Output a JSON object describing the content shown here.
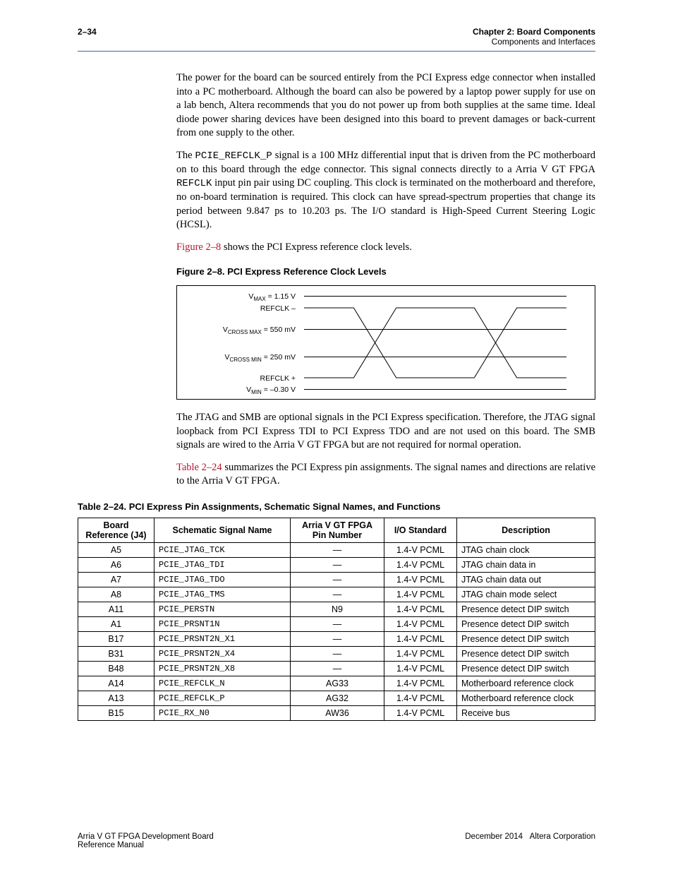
{
  "header": {
    "page_num": "2–34",
    "chapter": "Chapter 2: Board Components",
    "section": "Components and Interfaces"
  },
  "para1": "The power for the board can be sourced entirely from the PCI Express edge connector when installed into a PC motherboard. Although the board can also be powered by a laptop power supply for use on a lab bench, Altera recommends that you do not power up from both supplies at the same time. Ideal diode power sharing devices have been designed into this board to prevent damages or back-current from one supply to the other.",
  "para2_pre": "The ",
  "para2_mono1": "PCIE_REFCLK_P",
  "para2_mid1": " signal is a 100 MHz differential input that is driven from the PC motherboard on to this board through the edge connector. This signal connects directly to a Arria V GT FPGA ",
  "para2_mono2": "REFCLK",
  "para2_mid2": " input pin pair using DC coupling. This clock is terminated on the motherboard and therefore, no on-board termination is required. This clock can have spread-spectrum properties that change its period between 9.847 ps to 10.203 ps. The I/O standard is High-Speed Current Steering Logic (HCSL).",
  "para3_link": "Figure 2–8",
  "para3_rest": " shows the PCI Express reference clock levels.",
  "figure_caption": "Figure 2–8. PCI Express Reference Clock Levels",
  "figure_labels": {
    "vmax": "VMAX = 1.15 V",
    "refclk_minus": "REFCLK –",
    "vcross_max": "VCROSS MAX = 550 mV",
    "vcross_min": "VCROSS MIN = 250 mV",
    "refclk_plus": "REFCLK +",
    "vmin": "VMIN = –0.30 V"
  },
  "chart_data": {
    "type": "line",
    "title": "PCI Express Reference Clock Levels",
    "y_markers": [
      {
        "label": "VMAX",
        "value_v": 1.15
      },
      {
        "label": "REFCLK –",
        "value_v": null
      },
      {
        "label": "VCROSS MAX",
        "value_mv": 550
      },
      {
        "label": "VCROSS MIN",
        "value_mv": 250
      },
      {
        "label": "REFCLK +",
        "value_v": null
      },
      {
        "label": "VMIN",
        "value_v": -0.3
      }
    ],
    "series": [
      {
        "name": "REFCLK +",
        "shape": "differential-cross-upper"
      },
      {
        "name": "REFCLK –",
        "shape": "differential-cross-lower"
      }
    ]
  },
  "para4": "The JTAG and SMB are optional signals in the PCI Express specification. Therefore, the JTAG signal loopback from PCI Express TDI to PCI Express TDO and are not used on this board. The SMB signals are wired to the Arria V GT FPGA but are not required for normal operation.",
  "para5_link": "Table 2–24",
  "para5_rest": " summarizes the PCI Express pin assignments. The signal names and directions are relative to the Arria V GT FPGA.",
  "table_caption": "Table 2–24. PCI Express Pin Assignments, Schematic Signal Names, and Functions",
  "table_headers": {
    "ref": "Board Reference (J4)",
    "sig": "Schematic Signal Name",
    "pin": "Arria V GT FPGA Pin Number",
    "io": "I/O Standard",
    "desc": "Description"
  },
  "table_rows": [
    {
      "ref": "A5",
      "sig": "PCIE_JTAG_TCK",
      "pin": "—",
      "io": "1.4-V PCML",
      "desc": "JTAG chain clock"
    },
    {
      "ref": "A6",
      "sig": "PCIE_JTAG_TDI",
      "pin": "—",
      "io": "1.4-V PCML",
      "desc": "JTAG chain data in"
    },
    {
      "ref": "A7",
      "sig": "PCIE_JTAG_TDO",
      "pin": "—",
      "io": "1.4-V PCML",
      "desc": "JTAG chain data out"
    },
    {
      "ref": "A8",
      "sig": "PCIE_JTAG_TMS",
      "pin": "—",
      "io": "1.4-V PCML",
      "desc": "JTAG chain mode select"
    },
    {
      "ref": "A11",
      "sig": "PCIE_PERSTN",
      "pin": "N9",
      "io": "1.4-V PCML",
      "desc": "Presence detect DIP switch"
    },
    {
      "ref": "A1",
      "sig": "PCIE_PRSNT1N",
      "pin": "—",
      "io": "1.4-V PCML",
      "desc": "Presence detect DIP switch"
    },
    {
      "ref": "B17",
      "sig": "PCIE_PRSNT2N_X1",
      "pin": "—",
      "io": "1.4-V PCML",
      "desc": "Presence detect DIP switch"
    },
    {
      "ref": "B31",
      "sig": "PCIE_PRSNT2N_X4",
      "pin": "—",
      "io": "1.4-V PCML",
      "desc": "Presence detect DIP switch"
    },
    {
      "ref": "B48",
      "sig": "PCIE_PRSNT2N_X8",
      "pin": "—",
      "io": "1.4-V PCML",
      "desc": "Presence detect DIP switch"
    },
    {
      "ref": "A14",
      "sig": "PCIE_REFCLK_N",
      "pin": "AG33",
      "io": "1.4-V PCML",
      "desc": "Motherboard reference clock"
    },
    {
      "ref": "A13",
      "sig": "PCIE_REFCLK_P",
      "pin": "AG32",
      "io": "1.4-V PCML",
      "desc": "Motherboard reference clock"
    },
    {
      "ref": "B15",
      "sig": "PCIE_RX_N0",
      "pin": "AW36",
      "io": "1.4-V PCML",
      "desc": "Receive bus"
    }
  ],
  "footer": {
    "left_line1": "Arria V GT FPGA Development Board",
    "left_line2": "Reference Manual",
    "right_date": "December 2014",
    "right_corp": "Altera Corporation"
  }
}
